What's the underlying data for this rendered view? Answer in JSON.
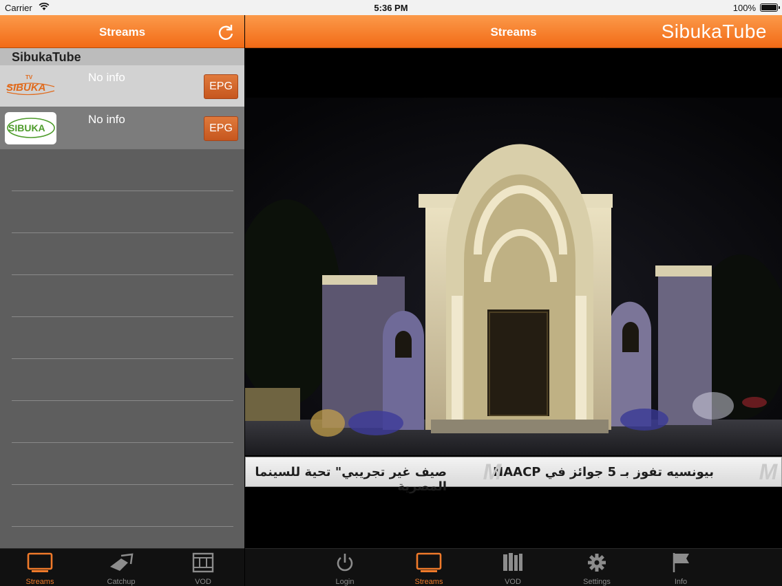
{
  "status_bar": {
    "carrier": "Carrier",
    "time": "5:36 PM",
    "battery": "100%"
  },
  "left_nav": {
    "title": "Streams"
  },
  "right_nav": {
    "title": "Streams",
    "brand": "SibukaTube"
  },
  "streams": {
    "section": "SibukaTube",
    "items": [
      {
        "logo_text": "SIBUKA",
        "info": "No info",
        "epg_label": "EPG"
      },
      {
        "logo_text": "SIBUKA",
        "info": "No info",
        "epg_label": "EPG"
      }
    ]
  },
  "ticker": {
    "headline_1": "بيونسيه تفوز بـ 5 جوائز في NAACP",
    "headline_2": "صيف غير تجريبي\" تحية للسينما المصرية"
  },
  "left_tabs": [
    {
      "label": "Streams",
      "icon": "tv-icon",
      "active": true
    },
    {
      "label": "Catchup",
      "icon": "catchup-icon",
      "active": false
    },
    {
      "label": "VOD",
      "icon": "film-icon",
      "active": false
    }
  ],
  "right_tabs": [
    {
      "label": "Login",
      "icon": "power-icon",
      "active": false
    },
    {
      "label": "Streams",
      "icon": "tv-icon",
      "active": true
    },
    {
      "label": "VOD",
      "icon": "books-icon",
      "active": false
    },
    {
      "label": "Settings",
      "icon": "gear-icon",
      "active": false
    },
    {
      "label": "Info",
      "icon": "flag-icon",
      "active": false
    }
  ],
  "colors": {
    "accent": "#f26b16",
    "tab_active": "#f07a2a",
    "tab_inactive": "#8c8c8c"
  }
}
